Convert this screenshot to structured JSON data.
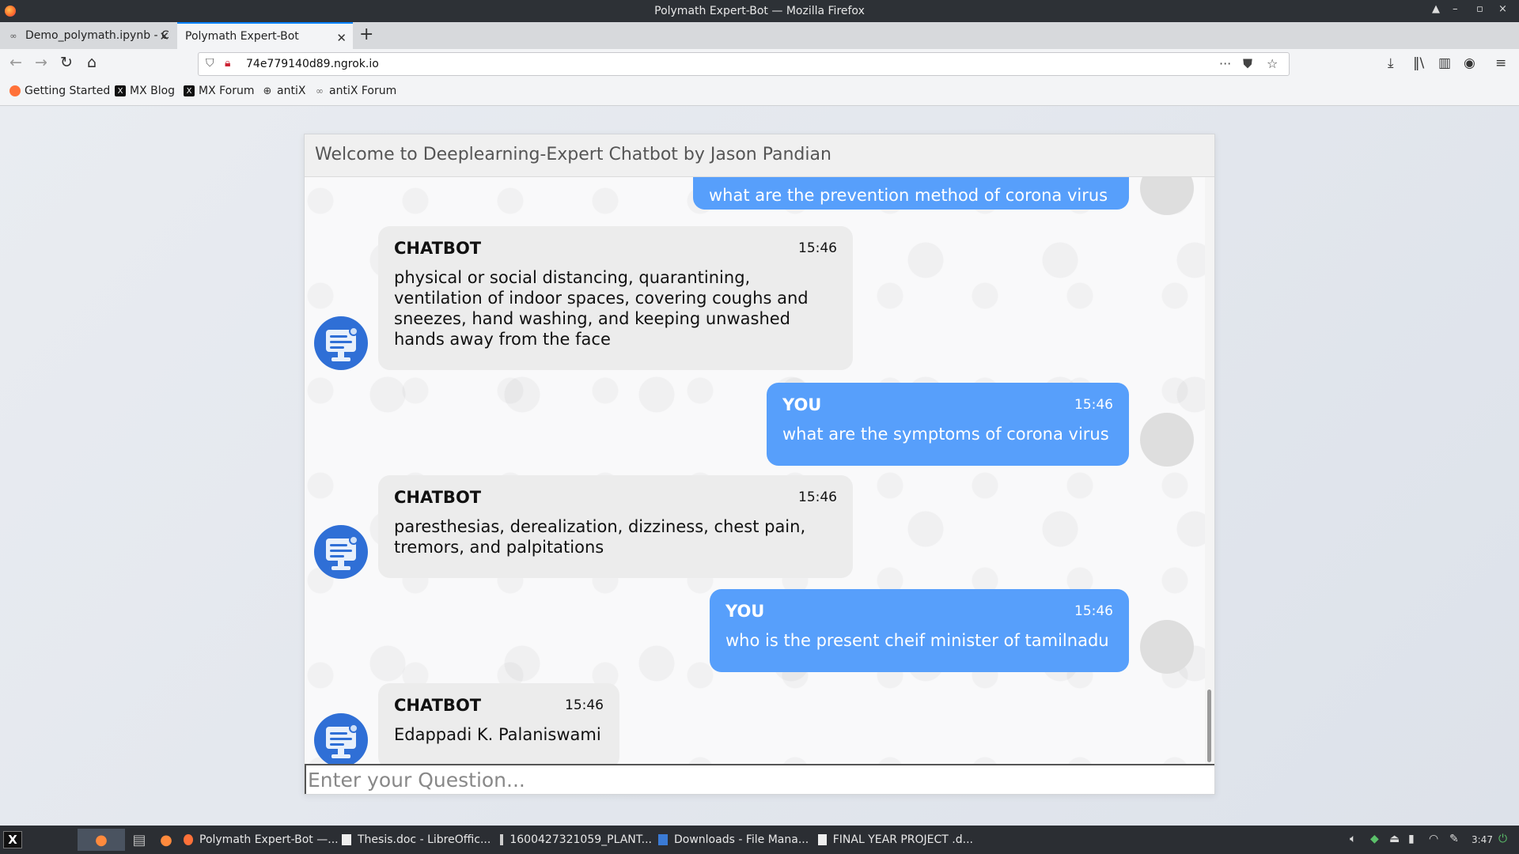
{
  "window": {
    "title": "Polymath Expert-Bot — Mozilla Firefox"
  },
  "tabs": [
    {
      "label": "Demo_polymath.ipynb - C"
    },
    {
      "label": "Polymath Expert-Bot"
    }
  ],
  "address_bar": {
    "url": "74e779140d89.ngrok.io"
  },
  "bookmarks": [
    {
      "label": "Getting Started"
    },
    {
      "label": "MX Blog"
    },
    {
      "label": "MX Forum"
    },
    {
      "label": "antiX"
    },
    {
      "label": "antiX Forum"
    }
  ],
  "chat": {
    "header": "Welcome to Deeplearning-Expert Chatbot by Jason Pandian",
    "messages": [
      {
        "sender": "",
        "time": "",
        "text": "what are the prevention method of corona virus"
      },
      {
        "sender": "CHATBOT",
        "time": "15:46",
        "text": "physical or social distancing, quarantining, ventilation of indoor spaces, covering coughs and sneezes, hand washing, and keeping unwashed hands away from the face"
      },
      {
        "sender": "YOU",
        "time": "15:46",
        "text": "what are the symptoms of corona virus"
      },
      {
        "sender": "CHATBOT",
        "time": "15:46",
        "text": "paresthesias, derealization, dizziness, chest pain, tremors, and palpitations"
      },
      {
        "sender": "YOU",
        "time": "15:46",
        "text": "who is the present cheif minister of tamilnadu"
      },
      {
        "sender": "CHATBOT",
        "time": "15:46",
        "text": "Edappadi K. Palaniswami"
      }
    ],
    "input": {
      "placeholder": "Enter your Question...",
      "value": ""
    }
  },
  "taskbar": {
    "tasks": [
      {
        "label": "Polymath Expert-Bot —..."
      },
      {
        "label": "Thesis.doc - LibreOffic..."
      },
      {
        "label": "1600427321059_PLANT..."
      },
      {
        "label": "Downloads - File Mana..."
      },
      {
        "label": "FINAL YEAR PROJECT .d..."
      }
    ],
    "clock": "3:47"
  },
  "colors": {
    "accent": "#0a84ff",
    "user_bubble": "#579ffb",
    "bot_bubble": "#ececec",
    "bot_avatar": "#2f6fd6"
  }
}
